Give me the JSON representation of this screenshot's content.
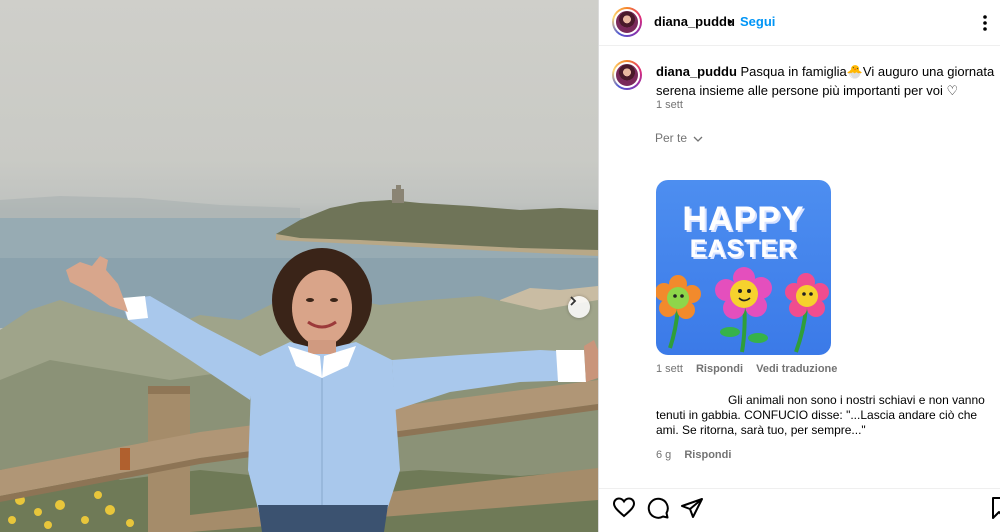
{
  "post": {
    "username": "diana_puddu",
    "dot": "•",
    "follow_label": "Segui"
  },
  "caption": {
    "username": "diana_puddu",
    "text": "Pasqua in famiglia🐣Vi auguro una giornata serena insieme alle persone più importanti per voi ♡",
    "time": "1 sett"
  },
  "for_you_label": "Per te",
  "comments": [
    {
      "sticker_text_1": "HAPPY",
      "sticker_text_2": "EASTER",
      "time": "1 sett",
      "reply_label": "Rispondi",
      "translate_label": "Vedi traduzione"
    },
    {
      "text": "Gli animali non sono i nostri schiavi e non vanno tenuti in gabbia. CONFUCIO disse: \"...Lascia andare ciò che ami. Se ritorna, sarà tuo, per sempre...\"",
      "time": "6 g",
      "reply_label": "Rispondi"
    }
  ],
  "colors": {
    "accent": "#0095f6",
    "muted": "#737373",
    "shirt": "#a9c8ec",
    "sea": "#8ba2ad"
  },
  "icons": [
    "heart-icon",
    "comment-icon",
    "share-icon",
    "bookmark-icon",
    "more-options-icon",
    "chevron-right-icon",
    "chevron-down-icon"
  ]
}
